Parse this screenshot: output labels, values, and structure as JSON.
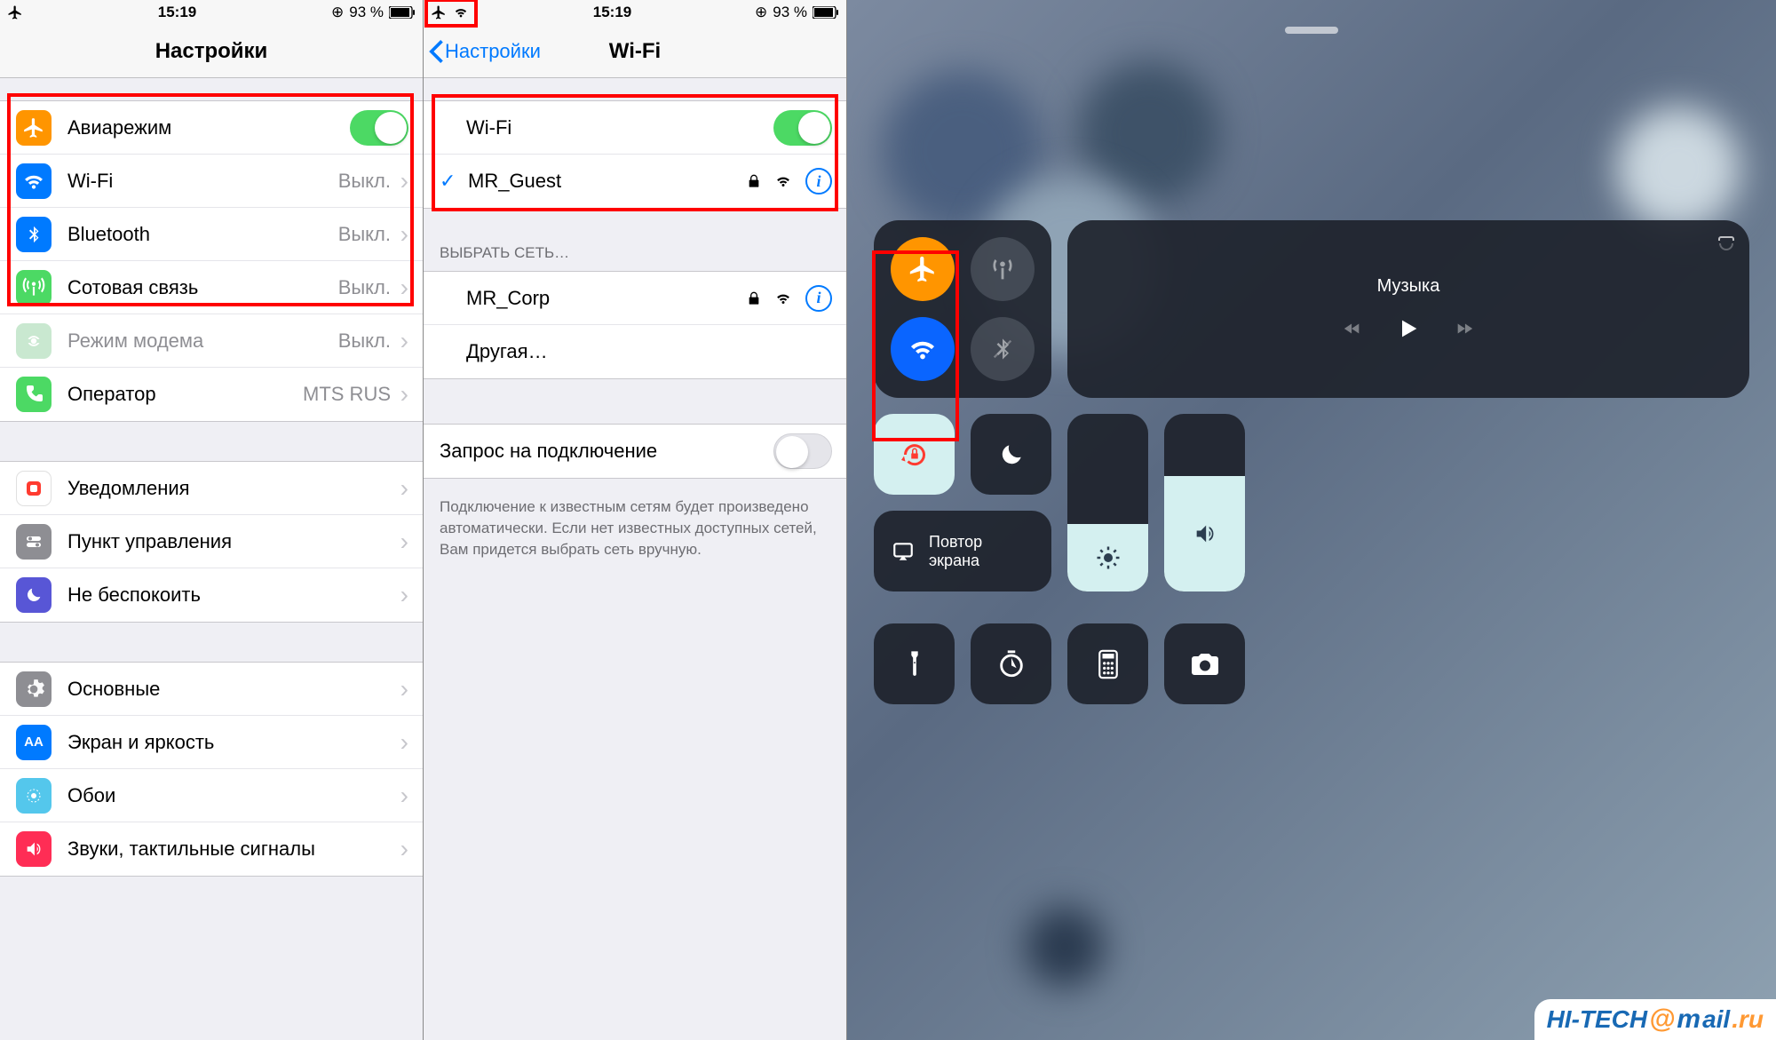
{
  "statusbar": {
    "time": "15:19",
    "battery_text": "93 %"
  },
  "pane1": {
    "title": "Настройки",
    "group1": [
      {
        "icon": "airplane",
        "label": "Авиарежим",
        "toggle": true
      },
      {
        "icon": "wifi",
        "label": "Wi-Fi",
        "value": "Выкл."
      },
      {
        "icon": "bluetooth",
        "label": "Bluetooth",
        "value": "Выкл."
      },
      {
        "icon": "cellular",
        "label": "Сотовая связь",
        "value": "Выкл."
      },
      {
        "icon": "hotspot",
        "label": "Режим модема",
        "value": "Выкл.",
        "disabled": true
      },
      {
        "icon": "carrier",
        "label": "Оператор",
        "value": "MTS RUS"
      }
    ],
    "group2": [
      {
        "icon": "notifications",
        "label": "Уведомления"
      },
      {
        "icon": "controlcenter",
        "label": "Пункт управления"
      },
      {
        "icon": "dnd",
        "label": "Не беспокоить"
      }
    ],
    "group3": [
      {
        "icon": "general",
        "label": "Основные"
      },
      {
        "icon": "display",
        "label": "Экран и яркость"
      },
      {
        "icon": "wallpaper",
        "label": "Обои"
      },
      {
        "icon": "sounds",
        "label": "Звуки, тактильные сигналы"
      }
    ]
  },
  "pane2": {
    "back_label": "Настройки",
    "title": "Wi-Fi",
    "wifi_label": "Wi-Fi",
    "connected_network": "MR_Guest",
    "choose_header": "ВЫБРАТЬ СЕТЬ…",
    "networks": [
      {
        "name": "MR_Corp",
        "locked": true
      },
      {
        "name": "Другая…",
        "locked": false
      }
    ],
    "ask_label": "Запрос на подключение",
    "footer": "Подключение к известным сетям будет произведено автоматически. Если нет известных доступных сетей, Вам придется выбрать сеть вручную."
  },
  "pane3": {
    "music_label": "Музыка",
    "screen_mirroring": "Повтор экрана"
  },
  "watermark": {
    "prefix": "HI-TECH",
    "suffix_a": "ail",
    "suffix_b": ".ru"
  }
}
